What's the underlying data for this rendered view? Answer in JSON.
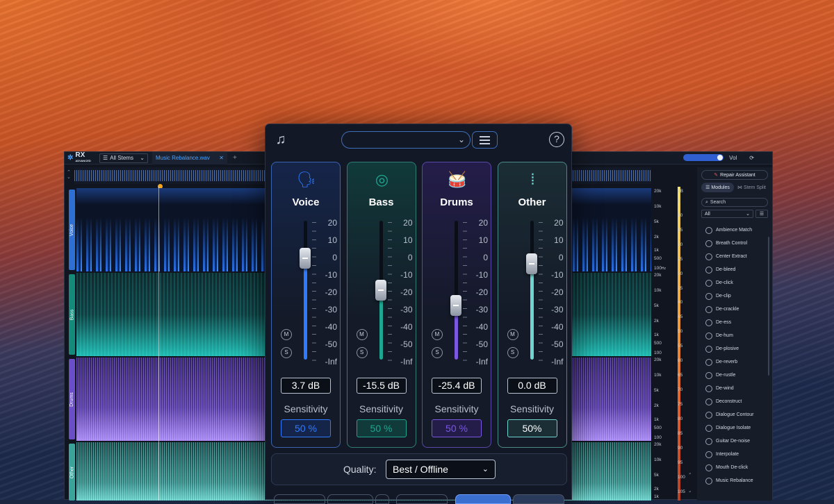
{
  "rx": {
    "logo": "RX",
    "logo_sub": "ADVANCED",
    "stems_dropdown": "All Stems",
    "file_tab": "Music Rebalance.wav",
    "close": "✕",
    "new_tab": "+",
    "vol_label": "Vol",
    "tracks": [
      "Voice",
      "Bass",
      "Drums",
      "Other"
    ],
    "freq_labels": [
      "20k",
      "10k",
      "5k",
      "2k",
      "1k",
      "500",
      "100",
      "20k",
      "10k",
      "5k",
      "2k",
      "1k",
      "500",
      "100",
      "20k",
      "10k",
      "5k",
      "2k",
      "1k",
      "500",
      "100",
      "20k",
      "10k",
      "5k",
      "2k",
      "1k"
    ],
    "hz_unit": "Hz",
    "meter_labels": [
      "dB",
      "5",
      "10",
      "15",
      "20",
      "25",
      "30",
      "35",
      "40",
      "45",
      "50",
      "55",
      "60",
      "65",
      "70",
      "75",
      "80",
      "85",
      "90",
      "95",
      "100",
      "105"
    ]
  },
  "panel": {
    "repair_assistant": "Repair Assistant",
    "modules_tab": "Modules",
    "stem_split_tab": "Stem Split",
    "search_placeholder": "Search",
    "filter": "All",
    "modules": [
      "Ambience Match",
      "Breath Control",
      "Center Extract",
      "De-bleed",
      "De-click",
      "De-clip",
      "De-crackle",
      "De-ess",
      "De-hum",
      "De-plosive",
      "De-reverb",
      "De-rustle",
      "De-wind",
      "Deconstruct",
      "Dialogue Contour",
      "Dialogue Isolate",
      "Guitar De-noise",
      "Interpolate",
      "Mouth De-click",
      "Music Rebalance"
    ]
  },
  "plugin": {
    "scale": [
      "20",
      "10",
      "0",
      "-10",
      "-20",
      "-30",
      "-40",
      "-50",
      "-Inf"
    ],
    "mute": "M",
    "solo": "S",
    "sensitivity_label": "Sensitivity",
    "strips": [
      {
        "name": "Voice",
        "value": "3.7 dB",
        "sensitivity": "50 %",
        "level": 0.79,
        "icon": "voice-icon",
        "glyph": "🗣",
        "color": "#2f7bff",
        "bg": "#152549",
        "border": "#3b65b0"
      },
      {
        "name": "Bass",
        "value": "-15.5 dB",
        "sensitivity": "50 %",
        "level": 0.56,
        "icon": "speaker-icon",
        "glyph": "◎",
        "color": "#1fa690",
        "bg": "#113a3a",
        "border": "#2f7d73"
      },
      {
        "name": "Drums",
        "value": "-25.4 dB",
        "sensitivity": "50 %",
        "level": 0.45,
        "icon": "drum-icon",
        "glyph": "🥁",
        "color": "#7a58e0",
        "bg": "#241d4a",
        "border": "#5a48a8"
      },
      {
        "name": "Other",
        "value": "0.0 dB",
        "sensitivity": "50%",
        "level": 0.75,
        "icon": "waveform-icon",
        "glyph": "⦙",
        "color": "#6fd6cf",
        "bg": "#1b2d35",
        "border": "#4b8a88"
      }
    ],
    "quality_label": "Quality:",
    "quality_value": "Best / Offline"
  }
}
